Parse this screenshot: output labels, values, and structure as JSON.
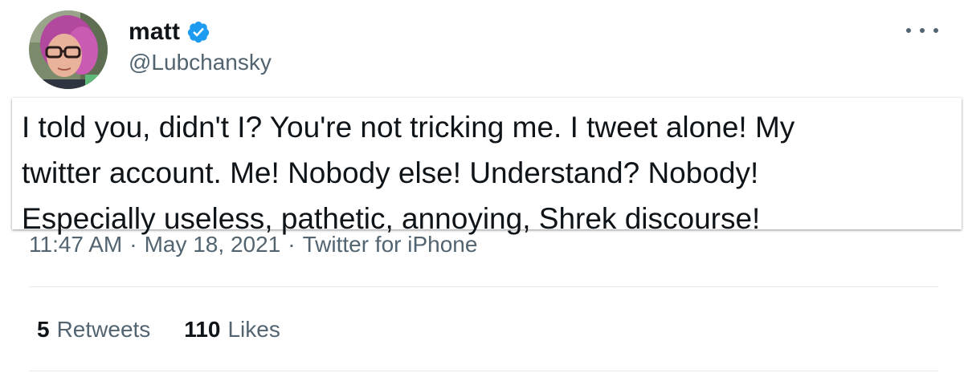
{
  "author": {
    "display_name": "matt",
    "handle": "@Lubchansky",
    "verified": true,
    "verified_color": "#1d9bf0"
  },
  "tweet": {
    "text": "I told you, didn't I? You're not tricking me. I tweet alone! My\ntwitter account. Me! Nobody else! Understand? Nobody!\nEspecially useless, pathetic, annoying, Shrek discourse!"
  },
  "meta": {
    "time": "11:47 AM",
    "separator": "·",
    "date": "May 18, 2021",
    "source": "Twitter for iPhone"
  },
  "stats": {
    "retweets_count": "5",
    "retweets_label": "Retweets",
    "likes_count": "110",
    "likes_label": "Likes"
  },
  "icons": {
    "more": "more-horizontal-icon",
    "verified": "verified-badge-icon"
  },
  "colors": {
    "text_primary": "#0f1419",
    "text_secondary": "#536471",
    "divider": "#e6e9eb"
  }
}
